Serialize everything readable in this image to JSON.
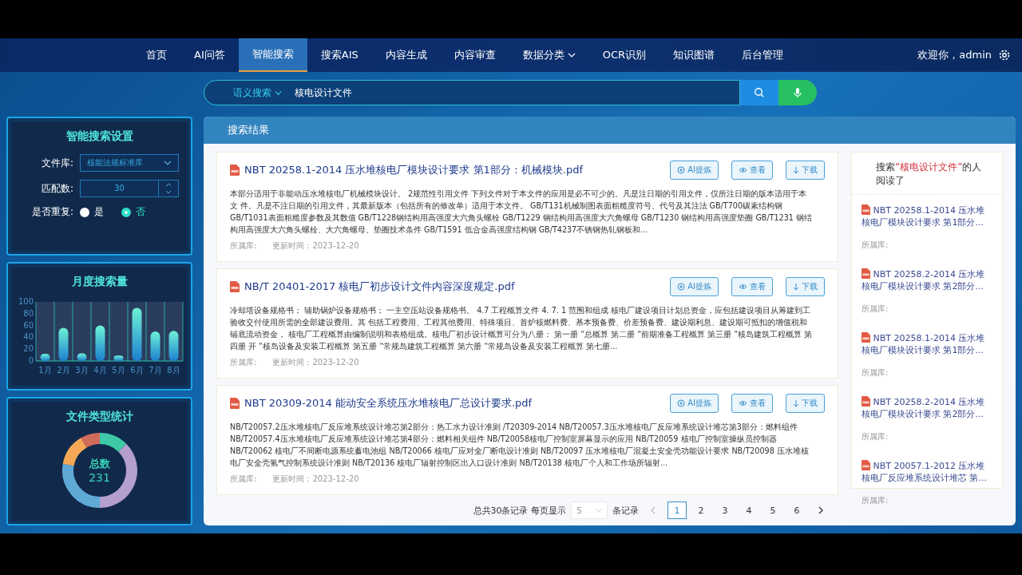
{
  "nav": {
    "items": [
      {
        "label": "首页",
        "selected": false,
        "dropdown": false
      },
      {
        "label": "AI问答",
        "selected": false,
        "dropdown": false
      },
      {
        "label": "智能搜索",
        "selected": true,
        "dropdown": false
      },
      {
        "label": "搜索AIS",
        "selected": false,
        "dropdown": false
      },
      {
        "label": "内容生成",
        "selected": false,
        "dropdown": false
      },
      {
        "label": "内容审查",
        "selected": false,
        "dropdown": false
      },
      {
        "label": "数据分类",
        "selected": false,
        "dropdown": true
      },
      {
        "label": "OCR识别",
        "selected": false,
        "dropdown": false
      },
      {
        "label": "知识图谱",
        "selected": false,
        "dropdown": false
      },
      {
        "label": "后台管理",
        "selected": false,
        "dropdown": false
      }
    ],
    "welcome": "欢迎你，admin"
  },
  "search": {
    "mode": "语义搜索",
    "value": "核电设计文件"
  },
  "settings": {
    "title": "智能搜索设置",
    "library_label": "文件库:",
    "library": "核能法规标准库",
    "match_label": "匹配数:",
    "match": "30",
    "repeat_label": "是否重复:",
    "options": [
      {
        "label": "是",
        "selected": false
      },
      {
        "label": "否",
        "selected": true
      }
    ]
  },
  "monthly": {
    "title": "月度搜索量",
    "chart_data": {
      "type": "bar",
      "categories": [
        "1月",
        "2月",
        "3月",
        "4月",
        "5月",
        "6月",
        "7月",
        "8月"
      ],
      "values": [
        12,
        56,
        13,
        60,
        9,
        90,
        50,
        51
      ],
      "ylim": [
        0,
        100
      ],
      "yticks": [
        0,
        20,
        40,
        60,
        80,
        100
      ]
    }
  },
  "file_types": {
    "title": "文件类型统计",
    "total_label": "总数",
    "total": "231"
  },
  "results": {
    "title": "搜索结果",
    "items": [
      {
        "title": "NBT 20258.1-2014 压水堆核电厂模块设计要求 第1部分：机械模块.pdf",
        "snippet": "本部分适用于非能动压水堆核电厂机械模块设计。 2规范性引用文件 下列文件对于本文件的应用是必不可少的。凡是注日期的引用文件，仅所注日期的版本适用于本文 件。凡是不注日期的引用文件，其最新版本（包括所有的修改单）适用于本文件。 GB/T131机械制图表面粗糙度符号、代号及其注法 GB/T700碳素结构钢 GB/T1031表面粗糙度参数及其数值 GB/T1228钢结构用高强度大六角头螺栓 GB/T1229 钢结构用高强度大六角螺母 GB/T1230 钢结构用高强度垫圈 GB/T1231 钢结构用高强度大六角头螺栓、大六角螺母、垫圈技术条件 GB/T1591 低合金高强度结构钢 GB/T4237不锈钢热轧钢板和...",
        "library_label": "所属库:",
        "updated": "更新时间：2023-12-20",
        "actions": [
          "AI提炼",
          "查看",
          "下载"
        ]
      },
      {
        "title": "NB/T 20401-2017 核电厂初步设计文件内容深度规定.pdf",
        "snippet": "冷却塔设备规格书； 辅助锅炉设备规格书； 一主空压站设备规格书。 4.7 工程概算文件 4. 7. 1 范围和组成 核电厂建设项目计划总资金，应包括建设项目从筹建到工验收交付使用所需的全部建设费用。其 包括工程费用、工程其他费用、特殊项目、首炉核燃料费、基本预备费、价差预备费、建设期利息、建设期可抵扣的增值税和铺底流动资金， 核电厂工程概算由编制说明和表格组成。核电厂初步设计概算可分为八册： 第一册 “总概算 第二册 “前期准备工程概算 第三册 “核岛建筑工程概算 第四册 开 “核岛设备及安装工程概算 第五册 “常规岛建筑工程概算 第六册 “常规岛设备及安装工程概算 第七册...",
        "library_label": "所属库:",
        "updated": "更新时间：2023-12-20",
        "actions": [
          "AI提炼",
          "查看",
          "下载"
        ]
      },
      {
        "title": "NBT 20309-2014 能动安全系统压水堆核电厂总设计要求.pdf",
        "snippet": "NB/T20057.2压水堆核电厂反应堆系统设计堆芯第2部分：热工水力设计准则 /T20309-2014 NB/T20057.3压水堆核电厂反应堆系统设计堆芯第3部分：燃料组件 NB/T20057.4压水堆核电厂反应堆系统设计堆芯第4部分：燃料相关组件 NB/T20058核电厂控制室屏幕显示的应用 NB/T20059 核电厂控制室操纵员控制器 NB/T20062 核电厂不间断电源系统蓄电池组 NB/T20066 核电厂应对全厂断电设计准则 NB/T20097 压水堆核电厂混凝土安全壳功能设计要求 NB/T20098 压水堆核电厂安全壳氢气控制系统设计准则 NB/T20136 核电厂辐射控制区出入口设计准则 NB/T20138 核电厂个人和工作场所辐射...",
        "library_label": "所属库:",
        "updated": "更新时间：2023-12-20",
        "actions": [
          "AI提炼",
          "查看",
          "下载"
        ]
      }
    ]
  },
  "pagination": {
    "summary": "总共30条记录 每页显示",
    "page_size": "5",
    "unit": "条记录",
    "pages": [
      {
        "label": "1",
        "selected": true
      },
      {
        "label": "2",
        "selected": false
      },
      {
        "label": "3",
        "selected": false
      },
      {
        "label": "4",
        "selected": false
      },
      {
        "label": "5",
        "selected": false
      },
      {
        "label": "6",
        "selected": false
      }
    ]
  },
  "related": {
    "prefix": "搜索",
    "keyword": "“核电设计文件”",
    "suffix": "的人阅读了",
    "items": [
      {
        "title": "NBT 20258.1-2014 压水堆核电厂模块设计要求 第1部分...",
        "library_label": "所属库:"
      },
      {
        "title": "NBT 20258.2-2014 压水堆核电厂模块设计要求 第2部分...",
        "library_label": "所属库:"
      },
      {
        "title": "NBT 20258.1-2014 压水堆核电厂模块设计要求 第1部分...",
        "library_label": "所属库:"
      },
      {
        "title": "NBT 20258.2-2014 压水堆核电厂模块设计要求 第2部分...",
        "library_label": "所属库:"
      },
      {
        "title": "NBT 20057.1-2012 压水堆核电厂反应堆系统设计堆芯 第...",
        "library_label": "所属库:"
      }
    ]
  }
}
